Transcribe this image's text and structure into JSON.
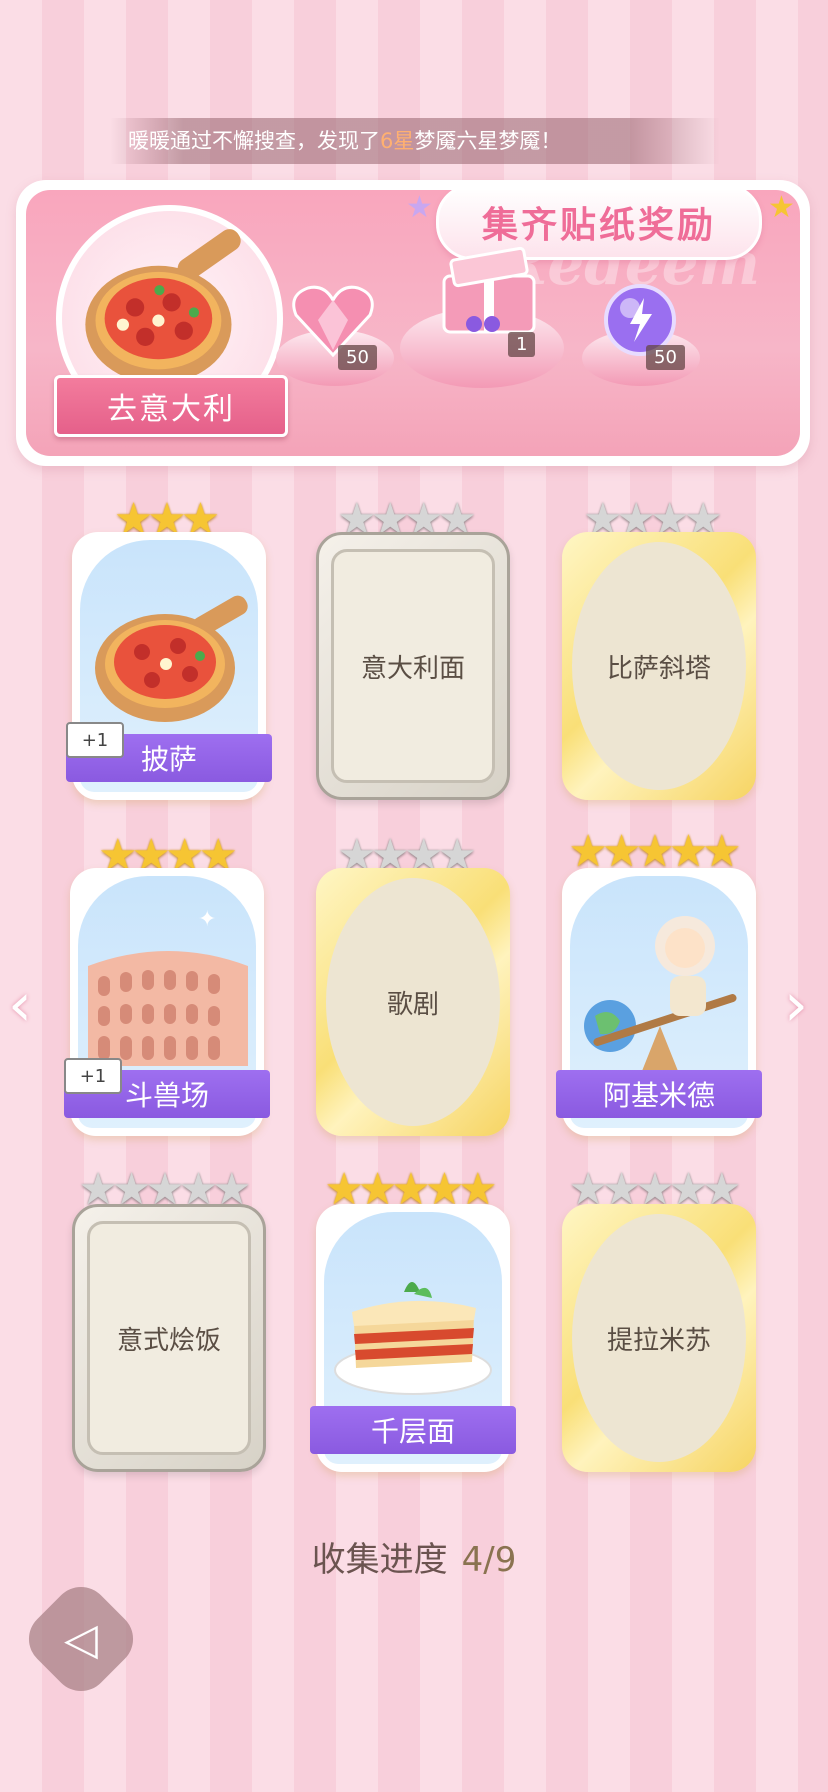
{
  "notice": {
    "prefix": "暖暖通过不懈搜查，发现了",
    "highlight": "6星",
    "suffix": "梦魇六星梦魇！"
  },
  "banner": {
    "title": "集齐贴纸奖励",
    "watermark": "Redeem",
    "city": "去意大利",
    "rewards": [
      {
        "icon": "pink-heart-gem-icon",
        "count": "50"
      },
      {
        "icon": "gift-box-icon",
        "count": "1"
      },
      {
        "icon": "purple-energy-orb-icon",
        "count": "50"
      }
    ]
  },
  "cards": [
    {
      "name": "披萨",
      "stars": 3,
      "collected": true,
      "plus": "+1",
      "frame": "photo",
      "icon": "pizza-icon"
    },
    {
      "name": "意大利面",
      "stars": 4,
      "collected": false,
      "frame": "silver"
    },
    {
      "name": "比萨斜塔",
      "stars": 4,
      "collected": false,
      "frame": "gold"
    },
    {
      "name": "斗兽场",
      "stars": 4,
      "collected": true,
      "plus": "+1",
      "frame": "photo",
      "icon": "colosseum-icon"
    },
    {
      "name": "歌剧",
      "stars": 4,
      "collected": false,
      "frame": "gold"
    },
    {
      "name": "阿基米德",
      "stars": 5,
      "collected": true,
      "frame": "photo",
      "icon": "archimedes-icon"
    },
    {
      "name": "意式烩饭",
      "stars": 5,
      "collected": false,
      "frame": "silver"
    },
    {
      "name": "千层面",
      "stars": 5,
      "collected": true,
      "frame": "photo",
      "icon": "lasagna-icon"
    },
    {
      "name": "提拉米苏",
      "stars": 5,
      "collected": false,
      "frame": "gold"
    }
  ],
  "progress": {
    "label": "收集进度",
    "value": "4/9"
  },
  "nav": {
    "left": "‹",
    "right": "›"
  },
  "colors": {
    "star_gold": "#f6c533",
    "star_grey": "#d6d6d6",
    "name_bar": "#9e6ff0",
    "accent": "#ef6d98"
  }
}
